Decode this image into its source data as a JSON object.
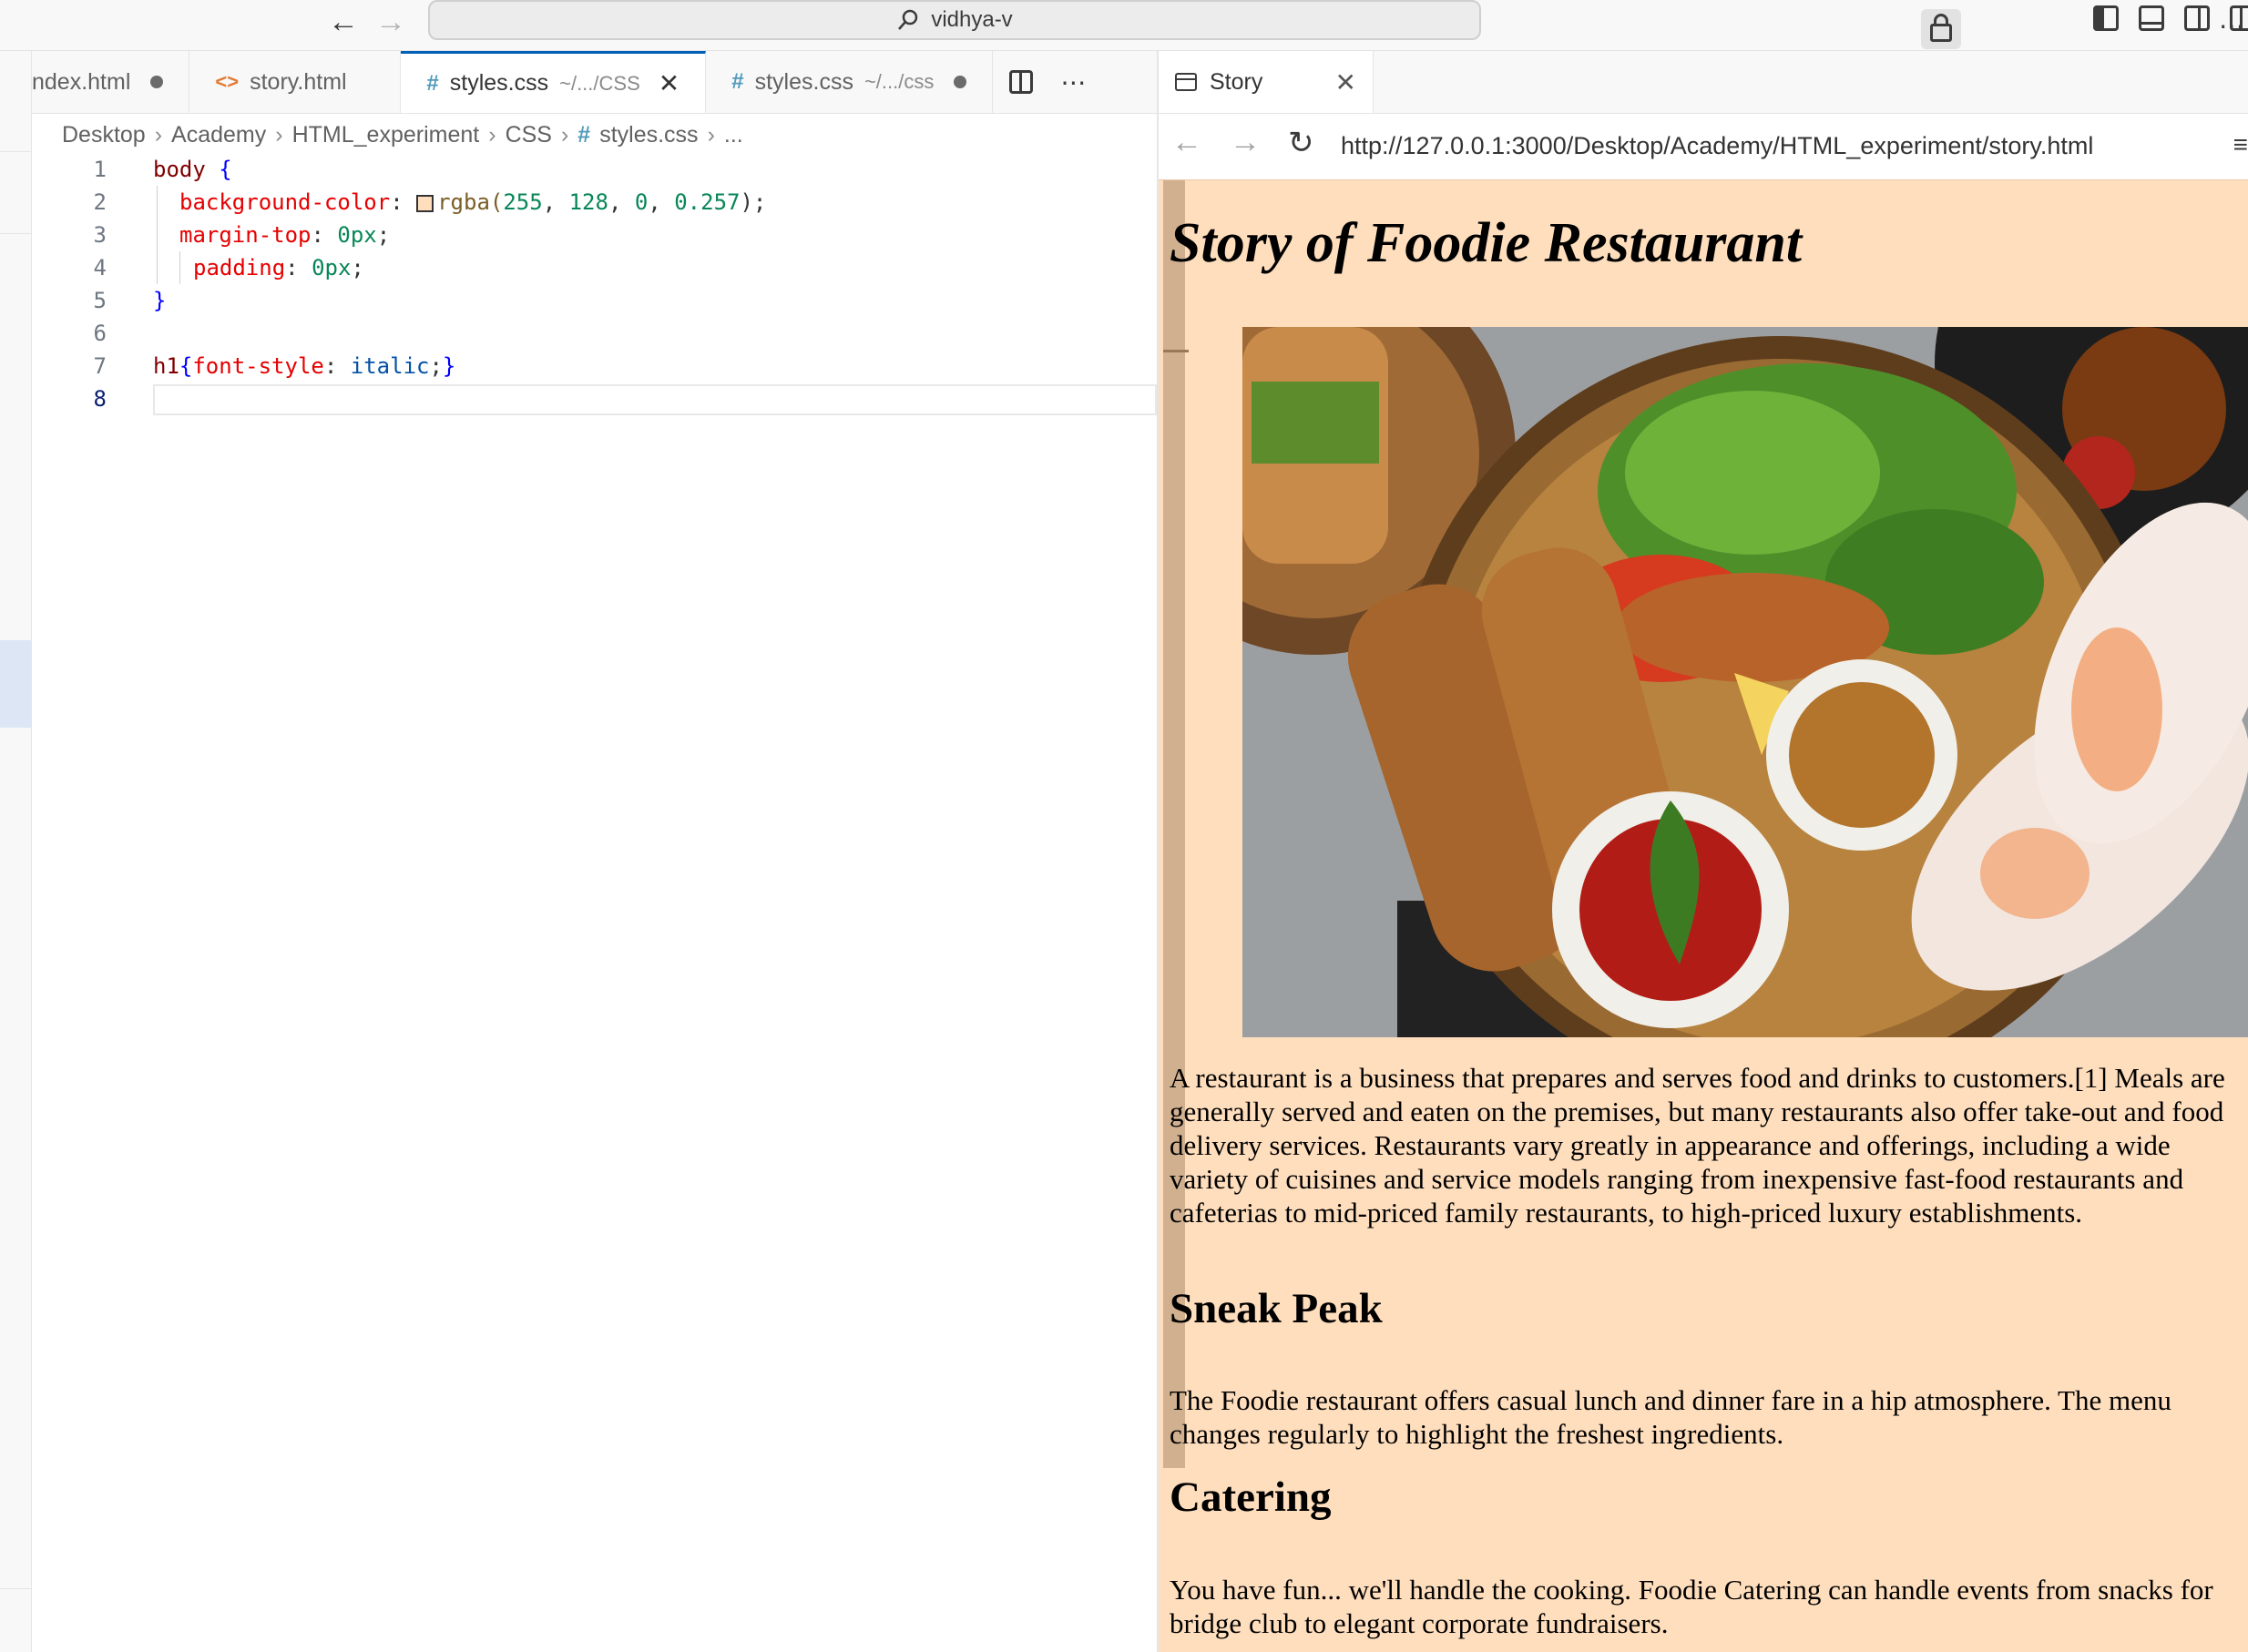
{
  "titlebar": {
    "search_text": "vidhya-v"
  },
  "tabs": [
    {
      "label": "ndex.html",
      "path": "",
      "modified": true,
      "active": false,
      "type": "html-partial"
    },
    {
      "label": "story.html",
      "path": "",
      "modified": false,
      "active": false,
      "type": "html"
    },
    {
      "label": "styles.css",
      "path": "~/.../CSS",
      "modified": false,
      "active": true,
      "type": "css"
    },
    {
      "label": "styles.css",
      "path": "~/.../css",
      "modified": true,
      "active": false,
      "type": "css"
    }
  ],
  "breadcrumb": {
    "items": [
      "Desktop",
      "Academy",
      "HTML_experiment",
      "CSS",
      "styles.css",
      "..."
    ]
  },
  "editor": {
    "line_numbers": [
      "1",
      "2",
      "3",
      "4",
      "5",
      "6",
      "7",
      "8"
    ],
    "current_line": "8",
    "code": {
      "l1_selector": "body",
      "l1_brace": " {",
      "l2_prop": "background-color",
      "l2_fn": "rgba(",
      "l2_n1": "255",
      "l2_n2": "128",
      "l2_n3": "0",
      "l2_n4": "0.257",
      "l3_prop": "margin-top",
      "l3_val": "0px",
      "l4_prop": "padding",
      "l4_val": "0px",
      "l5_brace": "}",
      "l7_selector": "h1",
      "l7_prop": "font-style",
      "l7_val": "italic"
    }
  },
  "preview": {
    "tab_label": "Story",
    "url": "http://127.0.0.1:3000/Desktop/Academy/HTML_experiment/story.html",
    "page_background": "#fadfc9",
    "h1": "Story of Foodie Restaurant",
    "p1": "A restaurant is a business that prepares and serves food and drinks to customers.[1] Meals are generally served and eaten on the premises, but many restaurants also offer take-out and food delivery services. Restaurants vary greatly in appearance and offerings, including a wide variety of cuisines and service models ranging from inexpensive fast-food restaurants and cafeterias to mid-priced family restaurants, to high-priced luxury establishments.",
    "h2_1": "Sneak Peak",
    "p2": "The Foodie restaurant offers casual lunch and dinner fare in a hip atmosphere. The menu changes regularly to highlight the freshest ingredients.",
    "h2_2": "Catering",
    "p3": "You have fun... we'll handle the cooking. Foodie Catering can handle events from snacks for bridge club to elegant corporate fundraisers."
  },
  "colors": {
    "accent": "#005fb8",
    "css_hash": "#519aba",
    "html_icon": "#e37933"
  }
}
